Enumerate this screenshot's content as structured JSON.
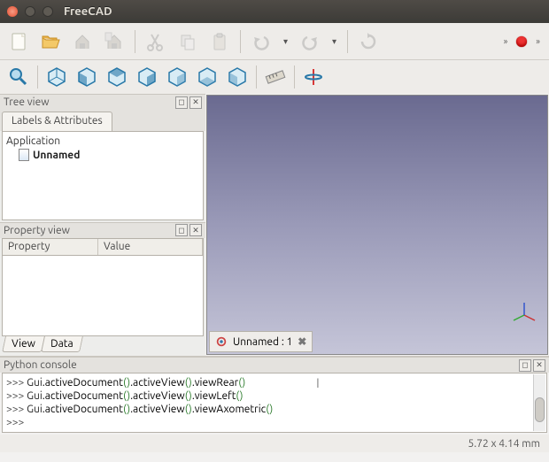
{
  "window": {
    "title": "FreeCAD"
  },
  "toolbar": {
    "overflow1": "»",
    "overflow2": "»"
  },
  "tree": {
    "panel_title": "Tree view",
    "tab_label": "Labels & Attributes",
    "root": "Application",
    "doc": "Unnamed"
  },
  "prop": {
    "panel_title": "Property view",
    "col1": "Property",
    "col2": "Value",
    "tab_view": "View",
    "tab_data": "Data"
  },
  "viewport": {
    "tab_label": "Unnamed : 1"
  },
  "console": {
    "panel_title": "Python console",
    "prompt": ">>> ",
    "lines": [
      {
        "pre": "Gui",
        "mid": ".activeDocument",
        "p1": "()",
        "mid2": ".activeView",
        "p2": "()",
        "mid3": ".viewRear",
        "p3": "()"
      },
      {
        "pre": "Gui",
        "mid": ".activeDocument",
        "p1": "()",
        "mid2": ".activeView",
        "p2": "()",
        "mid3": ".viewLeft",
        "p3": "()"
      },
      {
        "pre": "Gui",
        "mid": ".activeDocument",
        "p1": "()",
        "mid2": ".activeView",
        "p2": "()",
        "mid3": ".viewAxometric",
        "p3": "()"
      }
    ]
  },
  "status": {
    "dims": "5.72 x 4.14 mm"
  }
}
